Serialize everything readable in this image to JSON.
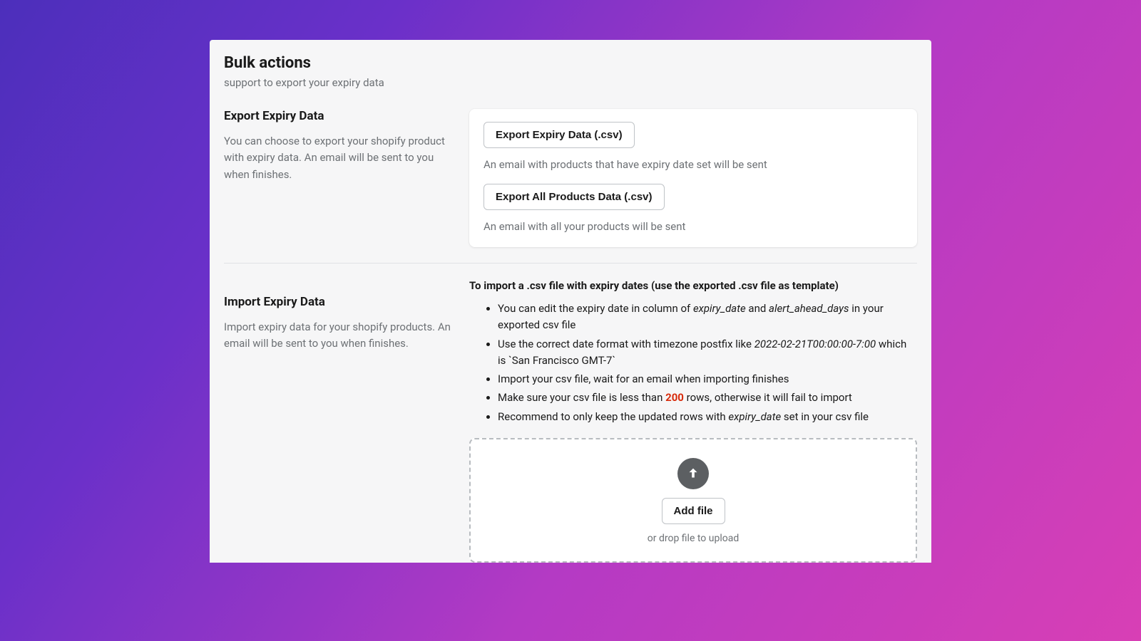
{
  "header": {
    "title": "Bulk actions",
    "subtitle": "support to export your expiry data"
  },
  "export": {
    "title": "Export Expiry Data",
    "desc": "You can choose to export your shopify product with expiry data. An email will be sent to you when finishes.",
    "btn_expiry": "Export Expiry Data (.csv)",
    "hint_expiry": "An email with products that have expiry date set will be sent",
    "btn_all": "Export All Products Data (.csv)",
    "hint_all": "An email with all your products will be sent"
  },
  "import": {
    "title": "Import Expiry Data",
    "desc": "Import expiry data for your shopify products. An email will be sent to you when finishes.",
    "heading": "To import a .csv file with expiry dates (use the exported .csv file as template)",
    "b1_a": "You can edit the expiry date in column of ",
    "b1_em1": "expiry_date",
    "b1_b": " and ",
    "b1_em2": "alert_ahead_days",
    "b1_c": " in your exported csv file",
    "b2_a": "Use the correct date format with timezone postfix like ",
    "b2_em": "2022-02-21T00:00:00-7:00",
    "b2_b": " which is  `San Francisco GMT-7`",
    "b3": "Import your csv file, wait for an email when importing finishes",
    "b4_a": "Make sure your csv file is less than ",
    "b4_num": "200",
    "b4_b": " rows, otherwise it will fail to import",
    "b5_a": "Recommend to only keep the updated rows with ",
    "b5_em": "expiry_date",
    "b5_b": " set in your csv file",
    "add_file": "Add file",
    "drop_hint": "or drop file to upload"
  }
}
